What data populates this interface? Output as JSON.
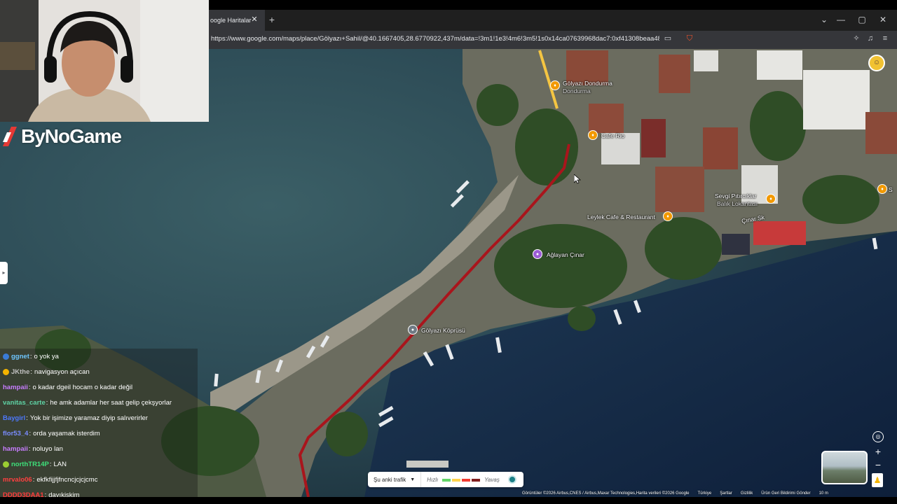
{
  "browser": {
    "tab_title": "oogle Haritalar",
    "tab_close": "✕",
    "new_tab": "+",
    "url": "https://www.google.com/maps/place/Gölyazı+Sahil/@40.1667405,28.6770922,437m/data=!3m1!1e3!4m6!3m5!1s0x14ca07639968dac7:0xf41308beaa482...",
    "window_controls": {
      "tabs_menu": "⌄",
      "minimize": "—",
      "maximize": "▢",
      "close": "✕"
    },
    "icons": [
      "cast-icon",
      "brave-shield-icon",
      "extensions-icon",
      "media-icon",
      "menu-icon"
    ]
  },
  "stream": {
    "logo_text": "ByNoGame"
  },
  "map": {
    "labels": [
      {
        "name": "golyazi-dondurma",
        "title": "Gölyazı Dondurma",
        "subtitle": "Dondurma",
        "pin": "orange"
      },
      {
        "name": "cafe-rio",
        "title": "Cafe Rio",
        "pin": "orange"
      },
      {
        "name": "sevgi-pitirciklar",
        "title": "Sevgi Pıtırcıklar",
        "subtitle": "Balık Lokantası",
        "pin": "orange"
      },
      {
        "name": "leylek-cafe",
        "title": "Leylek Cafe & Restaurant",
        "pin": "orange"
      },
      {
        "name": "aglayan-cinar",
        "title": "Ağlayan Çınar",
        "pin": "purple"
      },
      {
        "name": "golyazi-koprusu",
        "title": "Gölyazı Köprüsü",
        "pin": "gray"
      },
      {
        "name": "cinar-sk",
        "title": "Çınar Sk"
      }
    ],
    "edge_pin_label": "S"
  },
  "chat": [
    {
      "user": "ggnet",
      "color": "#6ec6ff",
      "message": "o yok ya",
      "badge": "#3a7bd5"
    },
    {
      "user": "JKthe",
      "color": "#c0c0c0",
      "message": "navigasyon açıcan",
      "badge": "#f4b400"
    },
    {
      "user": "hampaii",
      "color": "#c77dff",
      "message": "o kadar dgeil hocam o kadar değil",
      "badge": ""
    },
    {
      "user": "vanitas_carte",
      "color": "#5fd3a5",
      "message": "he amk adamlar her saat gelip çekşyorlar",
      "badge": ""
    },
    {
      "user": "Baygirl",
      "color": "#4d79ff",
      "message": "Yok bir işimize yaramaz diyip salıverirler",
      "badge": ""
    },
    {
      "user": "flor53_4",
      "color": "#7a8cff",
      "message": "orda yaşamak isterdim",
      "badge": ""
    },
    {
      "user": "hampaii",
      "color": "#c77dff",
      "message": "noluyo lan",
      "badge": ""
    },
    {
      "user": "northTR14P",
      "color": "#3ee07a",
      "message": "LAN",
      "badge": "#9acd32"
    },
    {
      "user": "mrvalo06",
      "color": "#ff4040",
      "message": "ekfkfijjfjfncncjcjcjcmc",
      "badge": ""
    },
    {
      "user": "DDDD3DAA1",
      "color": "#ff3b3b",
      "message": "dayıkiskim",
      "badge": ""
    }
  ],
  "traffic": {
    "label": "Şu anki trafik",
    "fast": "Hızlı",
    "slow": "Yavaş",
    "colors": [
      "#63d668",
      "#ffd34d",
      "#f23c32",
      "#811f1f"
    ]
  },
  "attribution": {
    "imagery": "Görüntüler ©2026 Airbus,CNES / Airbus,Maxar Technologies,Harita verileri ©2026 Google",
    "country": "Türkiye",
    "terms": "Şartlar",
    "privacy": "Gizlilik",
    "feedback": "Ürün Geri Bildirimi Gönder",
    "scale": "10 m"
  },
  "controls": {
    "zoom_in": "+",
    "zoom_out": "−"
  }
}
